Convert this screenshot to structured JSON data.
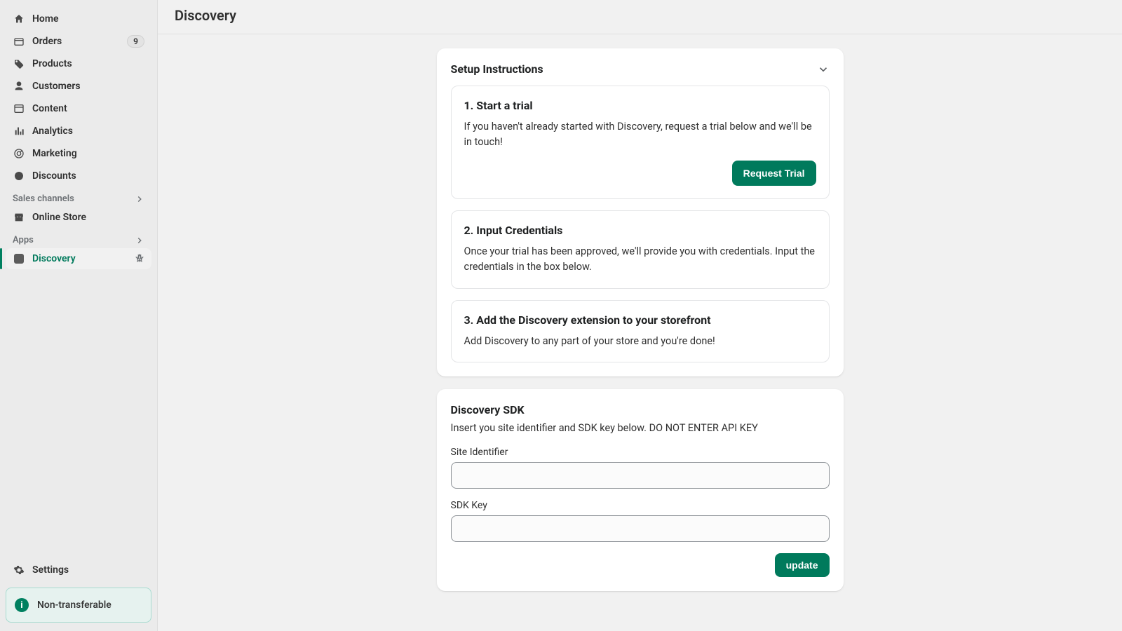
{
  "page": {
    "title": "Discovery"
  },
  "sidebar": {
    "items": [
      {
        "label": "Home"
      },
      {
        "label": "Orders",
        "badge": "9"
      },
      {
        "label": "Products"
      },
      {
        "label": "Customers"
      },
      {
        "label": "Content"
      },
      {
        "label": "Analytics"
      },
      {
        "label": "Marketing"
      },
      {
        "label": "Discounts"
      }
    ],
    "sections": {
      "sales_channels": "Sales channels",
      "apps": "Apps"
    },
    "online_store": "Online Store",
    "discovery": "Discovery",
    "settings": "Settings",
    "callout": "Non-transferable"
  },
  "setup": {
    "title": "Setup Instructions",
    "steps": [
      {
        "title": "1. Start a trial",
        "text": "If you haven't already started with Discovery, request a trial below and we'll be in touch!",
        "button": "Request Trial"
      },
      {
        "title": "2. Input Credentials",
        "text": "Once your trial has been approved, we'll provide you with credentials. Input the credentials in the box below."
      },
      {
        "title": "3. Add the Discovery extension to your storefront",
        "text": "Add Discovery to any part of your store and you're done!"
      }
    ]
  },
  "sdk": {
    "title": "Discovery SDK",
    "desc": "Insert you site identifier and SDK key below. DO NOT ENTER API KEY",
    "site_label": "Site Identifier",
    "key_label": "SDK Key",
    "button": "update"
  }
}
